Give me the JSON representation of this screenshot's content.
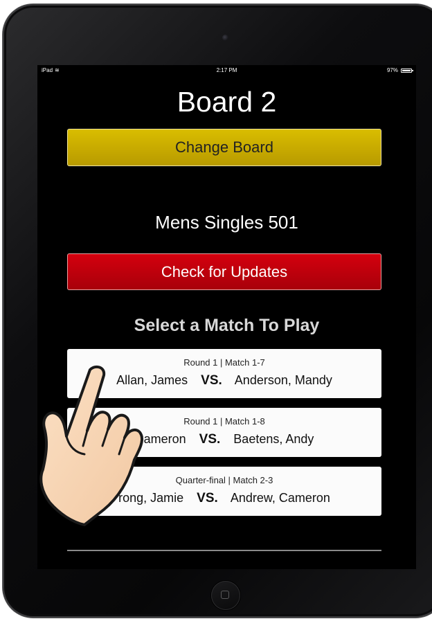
{
  "status_bar": {
    "device": "iPad",
    "time": "2:17 PM",
    "battery": "97%"
  },
  "board": {
    "title": "Board 2",
    "change_label": "Change Board"
  },
  "event": {
    "title": "Mens Singles 501"
  },
  "updates": {
    "label": "Check for Updates"
  },
  "matches": {
    "heading": "Select a Match To Play",
    "vs_label": "VS.",
    "items": [
      {
        "round": "Round 1 | Match 1-7",
        "player1": "Allan, James",
        "player2": "Anderson, Mandy"
      },
      {
        "round": "Round 1 | Match 1-8",
        "player1": "Cameron",
        "player2": "Baetens, Andy"
      },
      {
        "round": "Quarter-final | Match 2-3",
        "player1": "rong, Jamie",
        "player2": "Andrew, Cameron"
      }
    ]
  },
  "colors": {
    "change_button": "#d4b600",
    "updates_button": "#c4000c",
    "screen_background": "#000000",
    "card_background": "#fbfbfb"
  },
  "icons": [
    "wifi-icon",
    "battery-icon",
    "home-button-icon",
    "front-camera-icon",
    "tap-hand-icon"
  ]
}
